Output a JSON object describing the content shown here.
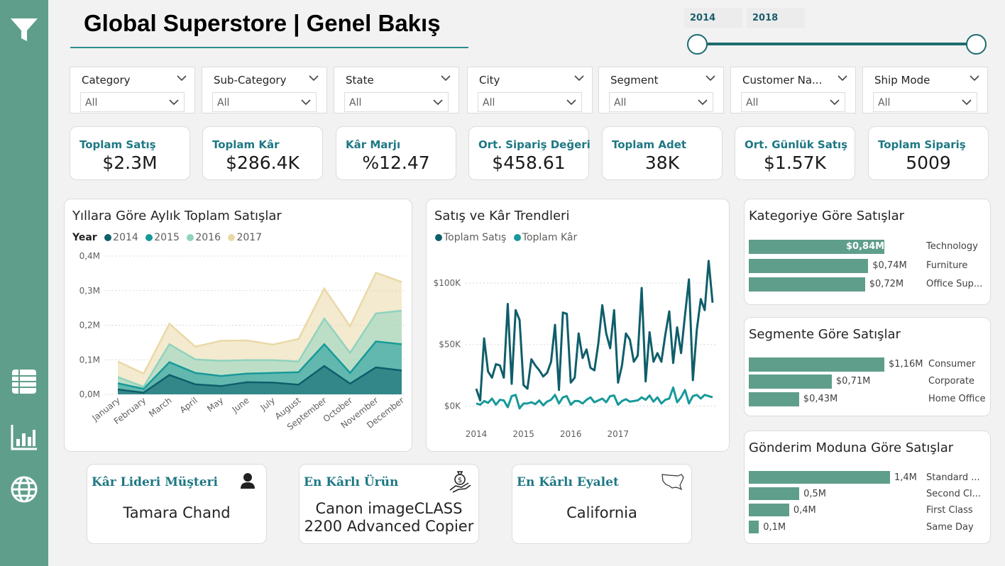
{
  "header": {
    "title": "Global Superstore | Genel Bakış"
  },
  "year_slider": {
    "start": "2014",
    "end": "2018"
  },
  "sidebar": {
    "icons": [
      "filter-icon",
      "table-icon",
      "bar-chart-icon",
      "globe-icon"
    ]
  },
  "filters": [
    {
      "label": "Category",
      "value": "All"
    },
    {
      "label": "Sub-Category",
      "value": "All"
    },
    {
      "label": "State",
      "value": "All"
    },
    {
      "label": "City",
      "value": "All"
    },
    {
      "label": "Segment",
      "value": "All"
    },
    {
      "label": "Customer Na...",
      "value": "All"
    },
    {
      "label": "Ship Mode",
      "value": "All"
    }
  ],
  "kpis": [
    {
      "label": "Toplam Satış",
      "value": "$2.3M"
    },
    {
      "label": "Toplam Kâr",
      "value": "$286.4K"
    },
    {
      "label": "Kâr Marjı",
      "value": "%12.47"
    },
    {
      "label": "Ort. Sipariş Değeri",
      "value": "$458.61"
    },
    {
      "label": "Toplam Adet",
      "value": "38K"
    },
    {
      "label": "Ort. Günlük Satış",
      "value": "$1.57K"
    },
    {
      "label": "Toplam Sipariş",
      "value": "5009"
    }
  ],
  "colors": {
    "accent": "#5f9e8b",
    "teal": "#1e7884",
    "dark_teal": "#0f5e6b"
  },
  "chart_data": [
    {
      "type": "area",
      "title": "Yıllara Göre Aylık Toplam Satışlar",
      "legend_title": "Year",
      "categories": [
        "January",
        "February",
        "March",
        "April",
        "May",
        "June",
        "July",
        "August",
        "September",
        "October",
        "November",
        "December"
      ],
      "series": [
        {
          "name": "2014",
          "color": "#0f5e6b",
          "values": [
            0.014,
            0.005,
            0.056,
            0.029,
            0.024,
            0.035,
            0.034,
            0.028,
            0.082,
            0.031,
            0.078,
            0.069
          ]
        },
        {
          "name": "2015",
          "color": "#17999a",
          "values": [
            0.018,
            0.011,
            0.037,
            0.033,
            0.029,
            0.025,
            0.028,
            0.036,
            0.063,
            0.031,
            0.075,
            0.076
          ]
        },
        {
          "name": "2016",
          "color": "#8fd3bf",
          "values": [
            0.018,
            0.006,
            0.052,
            0.039,
            0.044,
            0.039,
            0.037,
            0.031,
            0.074,
            0.058,
            0.081,
            0.097
          ]
        },
        {
          "name": "2017",
          "color": "#ead9a7",
          "values": [
            0.045,
            0.038,
            0.059,
            0.037,
            0.058,
            0.057,
            0.045,
            0.065,
            0.087,
            0.077,
            0.118,
            0.083
          ]
        }
      ],
      "ylim": [
        0,
        0.4
      ],
      "yticks": [
        "0,0M",
        "0,1M",
        "0,2M",
        "0,3M",
        "0,4M"
      ],
      "stacked": true
    },
    {
      "type": "line",
      "title": "Satış ve Kâr Trendleri",
      "xticks": [
        "2014",
        "2015",
        "2016",
        "2017"
      ],
      "yticks": [
        "$0K",
        "$50K",
        "$100K"
      ],
      "ylim": [
        -5000,
        122000
      ],
      "series": [
        {
          "name": "Toplam Satış",
          "color": "#0f5e6b",
          "values": [
            14000,
            4500,
            55000,
            28000,
            23000,
            34000,
            33000,
            23000,
            83000,
            18000,
            78000,
            70000,
            17000,
            14000,
            38000,
            33000,
            29000,
            24000,
            27000,
            36000,
            66000,
            13000,
            76000,
            75000,
            19000,
            23000,
            59000,
            39000,
            46000,
            31000,
            29000,
            51000,
            82000,
            59000,
            47000,
            78000,
            19000,
            33000,
            59000,
            54000,
            36000,
            41000,
            96000,
            20000,
            60000,
            36000,
            43000,
            36000,
            58000,
            77000,
            35000,
            64000,
            43000,
            74000,
            103000,
            21000,
            62000,
            87000,
            78000,
            118000,
            84000
          ]
        },
        {
          "name": "Toplam Kâr",
          "color": "#17999a",
          "values": [
            2000,
            1000,
            4000,
            2500,
            6000,
            1000,
            5000,
            4500,
            -1000,
            8000,
            9000,
            -2000,
            2000,
            2000,
            3000,
            1500,
            4500,
            500,
            3500,
            5000,
            9000,
            2000,
            7000,
            8000,
            1000,
            4000,
            4000,
            2000,
            5000,
            7000,
            3000,
            4500,
            6000,
            3000,
            8000,
            8500,
            1000,
            4000,
            5500,
            3500,
            4000,
            4500,
            7000,
            5000,
            8500,
            3500,
            7000,
            2000,
            5000,
            6000,
            15000,
            3000,
            7000,
            13000,
            2000,
            8000,
            9000,
            6000,
            9000,
            8000,
            7000
          ]
        }
      ]
    },
    {
      "type": "bar",
      "title": "Kategoriye Göre Satışlar",
      "categories": [
        "Technology",
        "Furniture",
        "Office Sup..."
      ],
      "values": [
        0.84,
        0.74,
        0.72
      ],
      "labels": [
        "$0,84M",
        "$0,74M",
        "$0,72M"
      ]
    },
    {
      "type": "bar",
      "title": "Segmente Göre Satışlar",
      "categories": [
        "Consumer",
        "Corporate",
        "Home Office"
      ],
      "values": [
        1.16,
        0.71,
        0.43
      ],
      "labels": [
        "$1,16M",
        "$0,71M",
        "$0,43M"
      ]
    },
    {
      "type": "bar",
      "title": "Gönderim Moduna Göre Satışlar",
      "categories": [
        "Standard ...",
        "Second Cl...",
        "First Class",
        "Same Day"
      ],
      "values": [
        1.4,
        0.5,
        0.4,
        0.1
      ],
      "labels": [
        "1,4M",
        "0,5M",
        "0,4M",
        "0,1M"
      ]
    }
  ],
  "info_cards": [
    {
      "label": "Kâr Lideri Müşteri",
      "value": "Tamara Chand",
      "icon": "person-icon"
    },
    {
      "label": "En Kârlı Ürün",
      "value": "Canon imageCLASS 2200 Advanced Copier",
      "icon": "money-hand-icon"
    },
    {
      "label": "En Kârlı Eyalet",
      "value": "California",
      "icon": "us-map-icon"
    }
  ]
}
